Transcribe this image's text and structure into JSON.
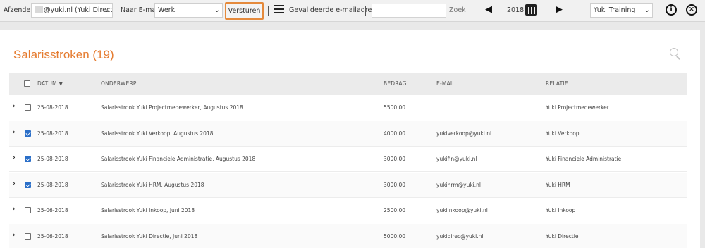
{
  "toolbar": {
    "sender_label": "Afzender:",
    "sender_value": "@yuki.nl (Yuki Directie)",
    "email_to_label": "Naar E-mail:",
    "email_to_value": "Werk",
    "send_label": "Versturen",
    "validated_label": "Gevalideerde e-mailadres...",
    "search_value": "",
    "search_button": "Zoek",
    "year": "2018",
    "admin_value": "Yuki Training"
  },
  "page": {
    "title": "Salarisstroken (19)"
  },
  "table": {
    "headers": {
      "date": "DATUM ▼",
      "subject": "ONDERWERP",
      "amount": "BEDRAG",
      "email": "E-MAIL",
      "relation": "RELATIE"
    },
    "rows": [
      {
        "checked": false,
        "date": "25-08-2018",
        "subject": "Salarisstrook Yuki Projectmedewerker, Augustus 2018",
        "amount": "5500.00",
        "email": "",
        "relation": "Yuki Projectmedewerker"
      },
      {
        "checked": true,
        "date": "25-08-2018",
        "subject": "Salarisstrook Yuki Verkoop, Augustus 2018",
        "amount": "4000.00",
        "email": "yukiverkoop@yuki.nl",
        "relation": "Yuki Verkoop"
      },
      {
        "checked": true,
        "date": "25-08-2018",
        "subject": "Salarisstrook Yuki Financiele Administratie, Augustus 2018",
        "amount": "3000.00",
        "email": "yukifin@yuki.nl",
        "relation": "Yuki Financiele Administratie"
      },
      {
        "checked": true,
        "date": "25-08-2018",
        "subject": "Salarisstrook Yuki HRM, Augustus 2018",
        "amount": "3000.00",
        "email": "yukihrm@yuki.nl",
        "relation": "Yuki HRM"
      },
      {
        "checked": false,
        "date": "25-06-2018",
        "subject": "Salarisstrook Yuki Inkoop, Juni 2018",
        "amount": "2500.00",
        "email": "yukiinkoop@yuki.nl",
        "relation": "Yuki Inkoop"
      },
      {
        "checked": false,
        "date": "25-06-2018",
        "subject": "Salarisstrook Yuki Directie, Juni 2018",
        "amount": "5000.00",
        "email": "yukidirec@yuki.nl",
        "relation": "Yuki Directie"
      }
    ]
  },
  "icons": {
    "menu": "hamburger-icon",
    "prev": "triangle-left-icon",
    "next": "triangle-right-icon",
    "calendar": "calendar-icon",
    "info": "info-icon",
    "close": "close-icon",
    "search": "search-icon"
  },
  "colors": {
    "accent": "#e57b2f",
    "checkbox": "#2b6fc8",
    "send_highlight": "#e58a3c"
  }
}
